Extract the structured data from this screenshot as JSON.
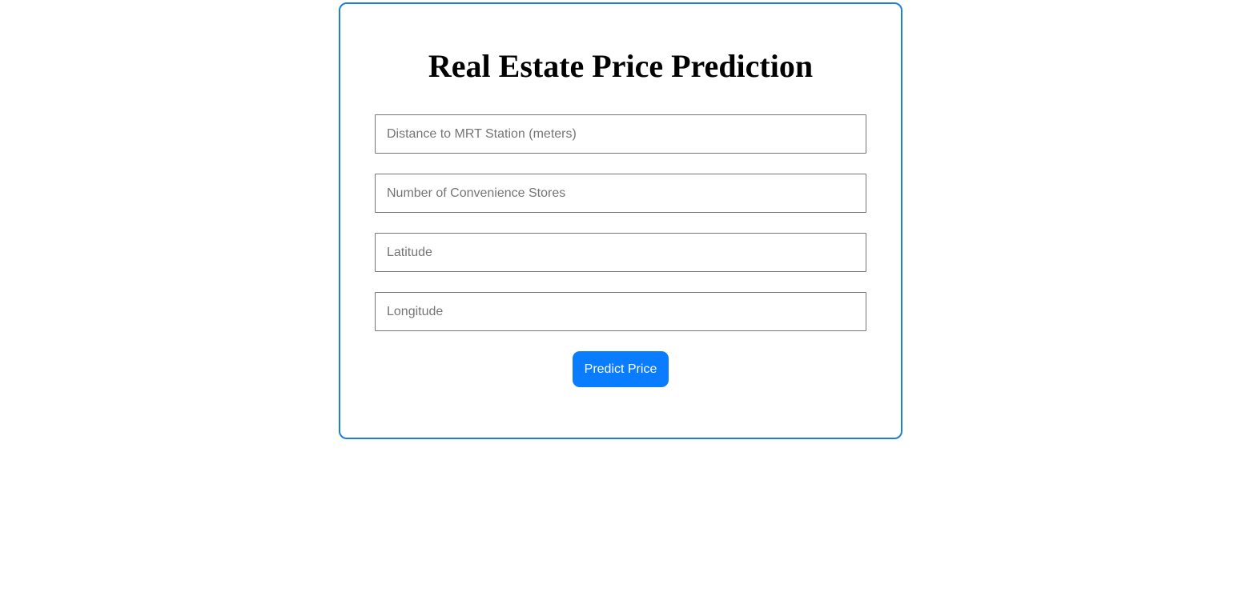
{
  "form": {
    "title": "Real Estate Price Prediction",
    "fields": [
      {
        "placeholder": "Distance to MRT Station (meters)",
        "value": ""
      },
      {
        "placeholder": "Number of Convenience Stores",
        "value": ""
      },
      {
        "placeholder": "Latitude",
        "value": ""
      },
      {
        "placeholder": "Longitude",
        "value": ""
      }
    ],
    "submit_label": "Predict Price"
  },
  "colors": {
    "accent": "#0a7cff",
    "card_border": "#1e7fd8"
  }
}
